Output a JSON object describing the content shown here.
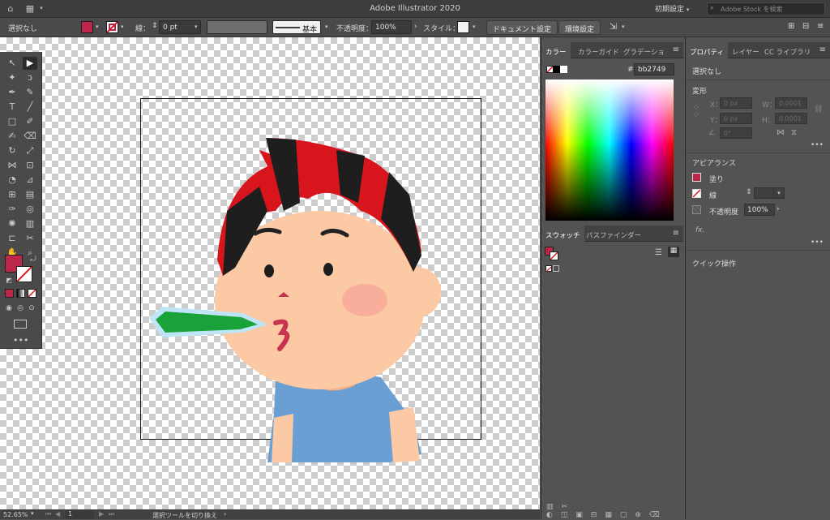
{
  "app": {
    "title": "Adobe Illustrator 2020",
    "workspace": "初期設定",
    "stock_search_placeholder": "Adobe Stock を検索"
  },
  "control_bar": {
    "selection": "選択なし",
    "stroke_label": "線：",
    "stroke_weight": "0 pt",
    "brush_label": "基本",
    "opacity_label": "不透明度：",
    "opacity_value": "100%",
    "style_label": "スタイル：",
    "document_setup": "ドキュメント設定",
    "preferences": "環境設定"
  },
  "color_panel": {
    "tabs": [
      "カラー",
      "カラーガイド",
      "グラデーショ"
    ],
    "hex_prefix": "#",
    "hex_value": "bb2749"
  },
  "swatch_panel": {
    "tabs": [
      "スウォッチ",
      "パスファインダー"
    ]
  },
  "properties_panel": {
    "tabs": [
      "プロパティ",
      "レイヤー",
      "CC ライブラリ"
    ],
    "selection": "選択なし",
    "transform_heading": "変形",
    "x_label": "X：",
    "x_value": "0 px",
    "y_label": "Y：",
    "y_value": "0 px",
    "w_label": "W：",
    "w_value": "0.0001",
    "h_label": "H：",
    "h_value": "0.0001",
    "angle_value": "0°",
    "appearance_heading": "アピアランス",
    "fill_label": "塗り",
    "stroke_label": "線",
    "opacity_label": "不透明度",
    "opacity_value": "100%",
    "fx_label": "fx.",
    "quick_actions_heading": "クイック操作"
  },
  "status_bar": {
    "zoom": "52.65%",
    "artboard_number": "1",
    "tool_hint": "選択ツールを切り換え"
  },
  "colors": {
    "fill": "#bb2749",
    "ui_dark": "#535353",
    "shirt": "#6a9fd4",
    "skin": "#fcc9a5",
    "hair_red": "#d8141c",
    "hair_black": "#1e1e1e",
    "breath_green": "#1aa23a"
  },
  "canvas": {
    "illustration": "boy-blowing-green-breath"
  }
}
